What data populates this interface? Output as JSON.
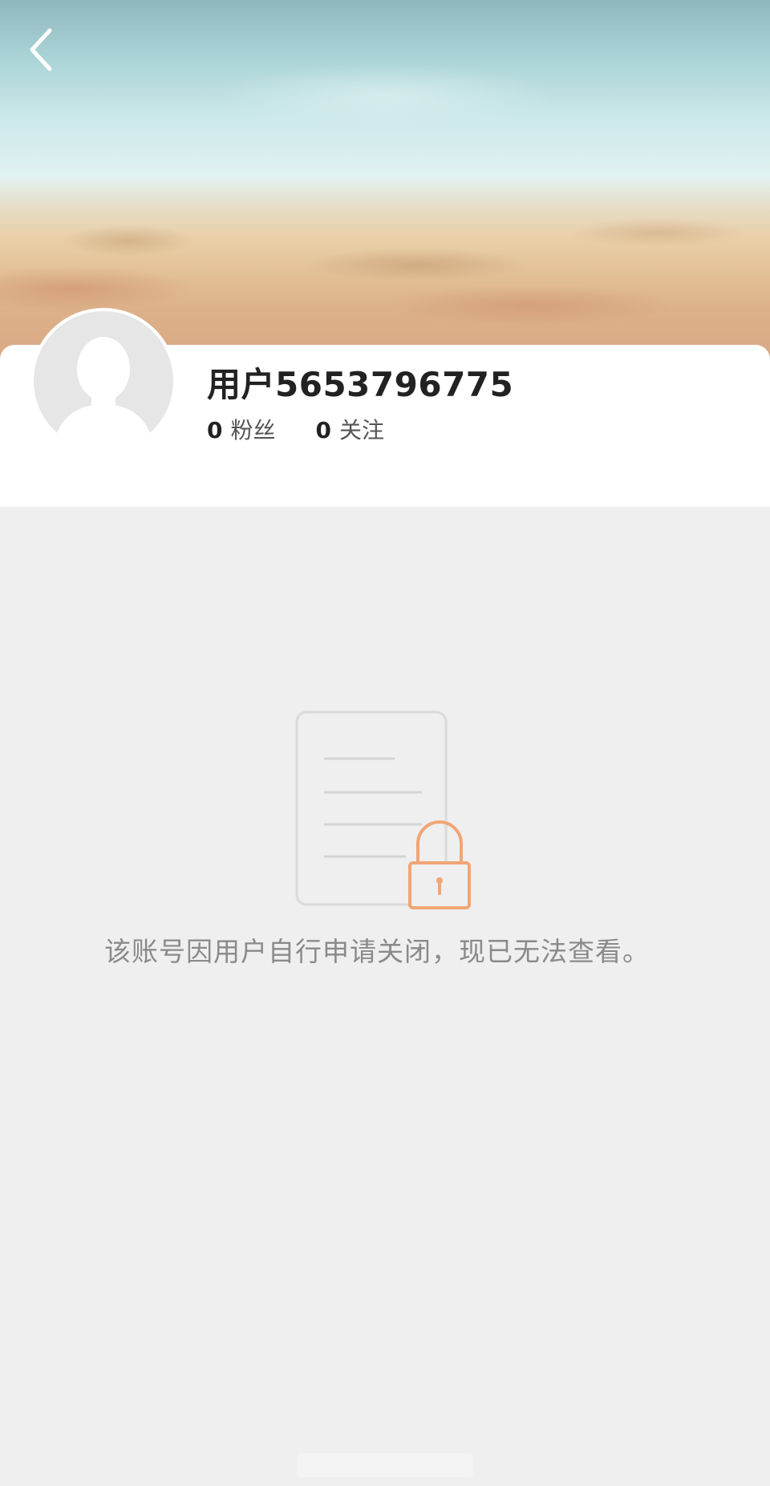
{
  "header": {
    "back_icon": "chevron-left-icon"
  },
  "profile": {
    "username": "用户5653796775",
    "avatar_icon": "default-avatar-icon",
    "stats": [
      {
        "value": "0",
        "label": "粉丝"
      },
      {
        "value": "0",
        "label": "关注"
      }
    ]
  },
  "empty_state": {
    "icon": "locked-document-icon",
    "message": "该账号因用户自行申请关闭，现已无法查看。"
  },
  "colors": {
    "accent": "#f0a675",
    "page_background": "#efefef",
    "card_background": "#ffffff",
    "message_text": "#8a8a8a"
  }
}
